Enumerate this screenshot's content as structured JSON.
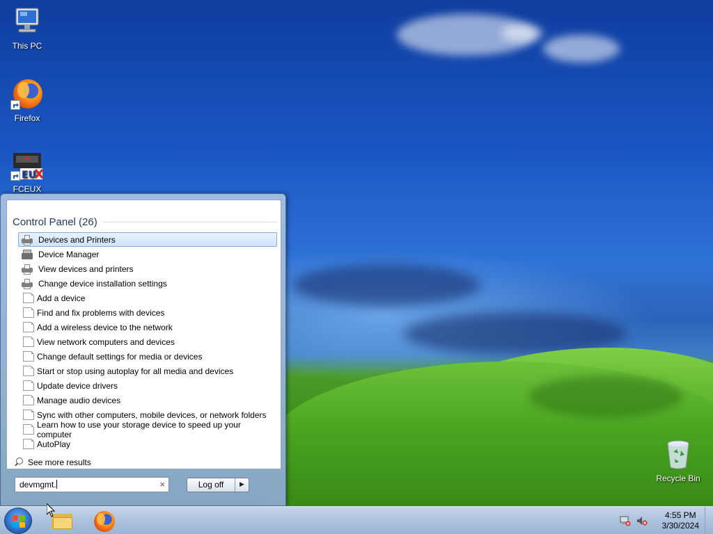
{
  "desktop": {
    "icons": [
      {
        "label": "This PC",
        "icon": "this-pc-icon"
      },
      {
        "label": "Firefox",
        "icon": "firefox-icon"
      },
      {
        "label": "FCEUX",
        "icon": "fceux-icon"
      },
      {
        "label": "Recycle Bin",
        "icon": "recycle-bin-icon"
      }
    ]
  },
  "start_menu": {
    "group_header": "Control Panel (26)",
    "results": [
      {
        "label": "Devices and Printers",
        "icon": "printer-icon",
        "selected": true
      },
      {
        "label": "Device Manager",
        "icon": "device-manager-icon"
      },
      {
        "label": "View devices and printers",
        "icon": "printer-icon"
      },
      {
        "label": "Change device installation settings",
        "icon": "printer-icon"
      },
      {
        "label": "Add a device",
        "icon": "page-icon"
      },
      {
        "label": "Find and fix problems with devices",
        "icon": "page-icon"
      },
      {
        "label": "Add a wireless device to the network",
        "icon": "page-icon"
      },
      {
        "label": "View network computers and devices",
        "icon": "page-icon"
      },
      {
        "label": "Change default settings for media or devices",
        "icon": "page-icon"
      },
      {
        "label": "Start or stop using autoplay for all media and devices",
        "icon": "page-icon"
      },
      {
        "label": "Update device drivers",
        "icon": "page-icon"
      },
      {
        "label": "Manage audio devices",
        "icon": "page-icon"
      },
      {
        "label": "Sync with other computers, mobile devices, or network folders",
        "icon": "page-icon"
      },
      {
        "label": "Learn how to use your storage device to speed up your computer",
        "icon": "page-icon"
      },
      {
        "label": "AutoPlay",
        "icon": "page-icon"
      }
    ],
    "see_more": "See more results",
    "search_value": "devmgmt.",
    "clear_glyph": "×",
    "logoff_label": "Log off",
    "logoff_arrow": "▶"
  },
  "taskbar": {
    "clock_time": "4:55 PM",
    "clock_date": "3/30/2024"
  },
  "colors": {
    "selection_bg": "#cfe3fa",
    "selection_border": "#84acdd",
    "group_header": "#1e395b"
  }
}
